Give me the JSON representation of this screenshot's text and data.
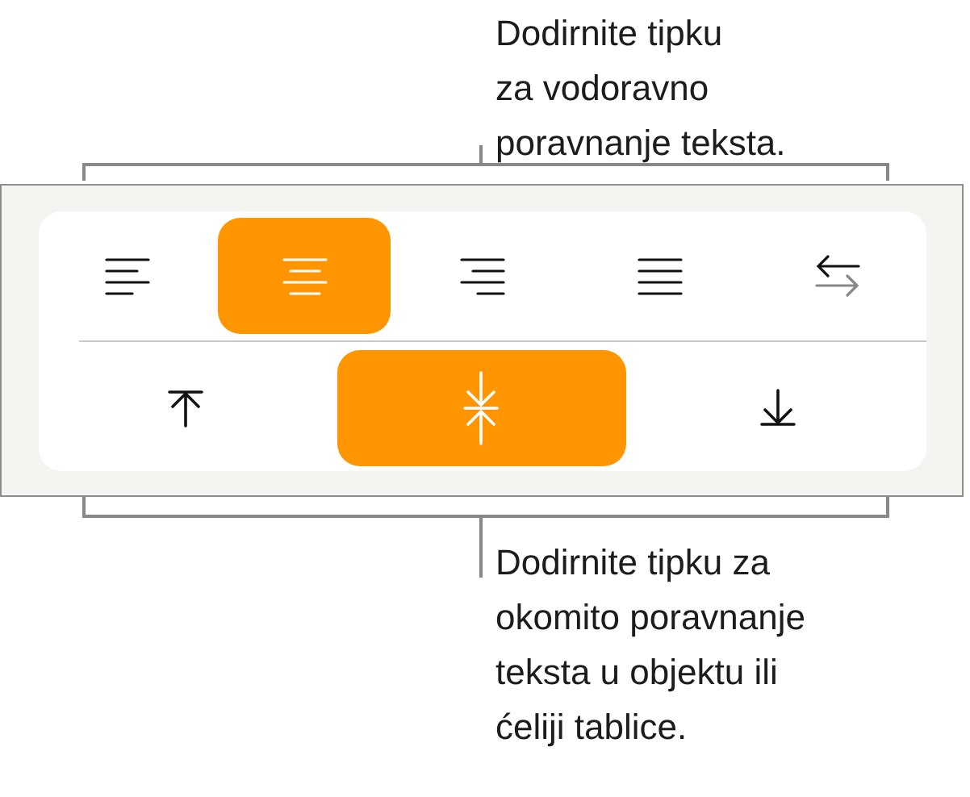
{
  "top_callout": {
    "lines": [
      "Dodirnite tipku",
      "za vodoravno",
      "poravnanje teksta."
    ]
  },
  "horizontal_alignment": [
    {
      "kind": "left",
      "selected": false
    },
    {
      "kind": "center",
      "selected": true
    },
    {
      "kind": "right",
      "selected": false
    },
    {
      "kind": "justify",
      "selected": false
    },
    {
      "kind": "direction",
      "selected": false
    }
  ],
  "vertical_alignment": [
    {
      "kind": "top",
      "selected": false
    },
    {
      "kind": "middle",
      "selected": true
    },
    {
      "kind": "bottom",
      "selected": false
    }
  ],
  "bottom_callout": {
    "lines": [
      "Dodirnite tipku za",
      "okomito poravnanje",
      "teksta u objektu ili",
      "ćeliji tablice."
    ]
  }
}
